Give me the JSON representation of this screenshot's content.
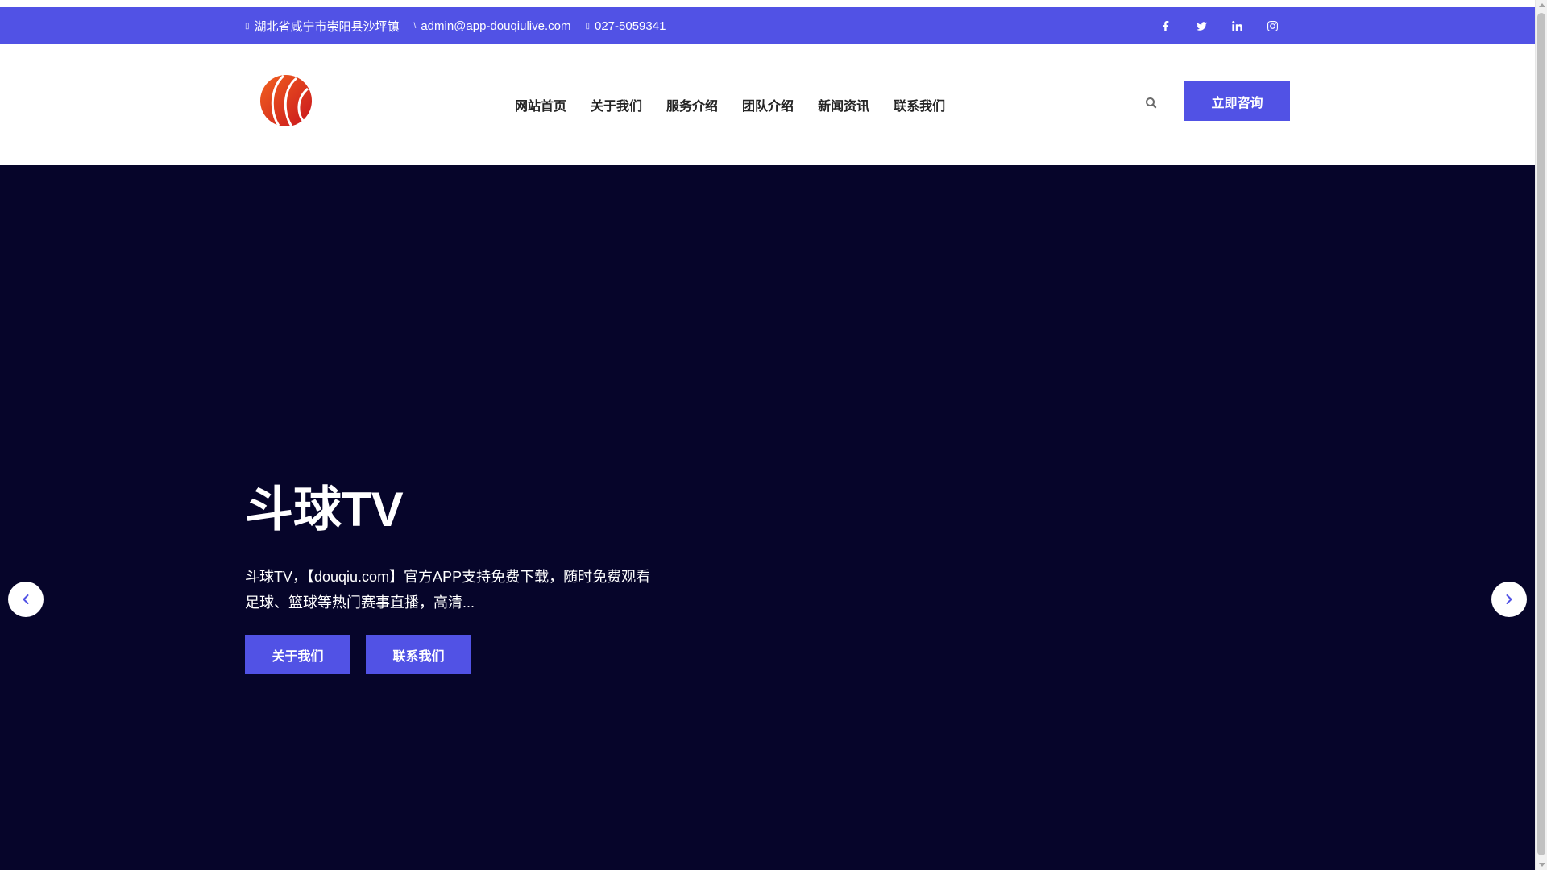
{
  "topbar": {
    "address": "湖北省咸宁市崇阳县沙坪镇",
    "email": "admin@app-douqiulive.com",
    "phone": "027-5059341",
    "socials": [
      "facebook-icon",
      "twitter-icon",
      "linkedin-icon",
      "instagram-icon"
    ]
  },
  "header": {
    "nav": [
      "网站首页",
      "关于我们",
      "服务介绍",
      "团队介绍",
      "新闻资讯",
      "联系我们"
    ],
    "cta_label": "立即咨询"
  },
  "hero": {
    "title": "斗球TV",
    "description": "斗球TV，【douqiu.com】官方APP支持免费下载，随时免费观看足球、篮球等热门赛事直播，高清...",
    "button_about": "关于我们",
    "button_contact": "联系我们"
  },
  "colors": {
    "accent": "#5152e5",
    "hero_bg": "#06052a",
    "nav_text": "#242424"
  }
}
